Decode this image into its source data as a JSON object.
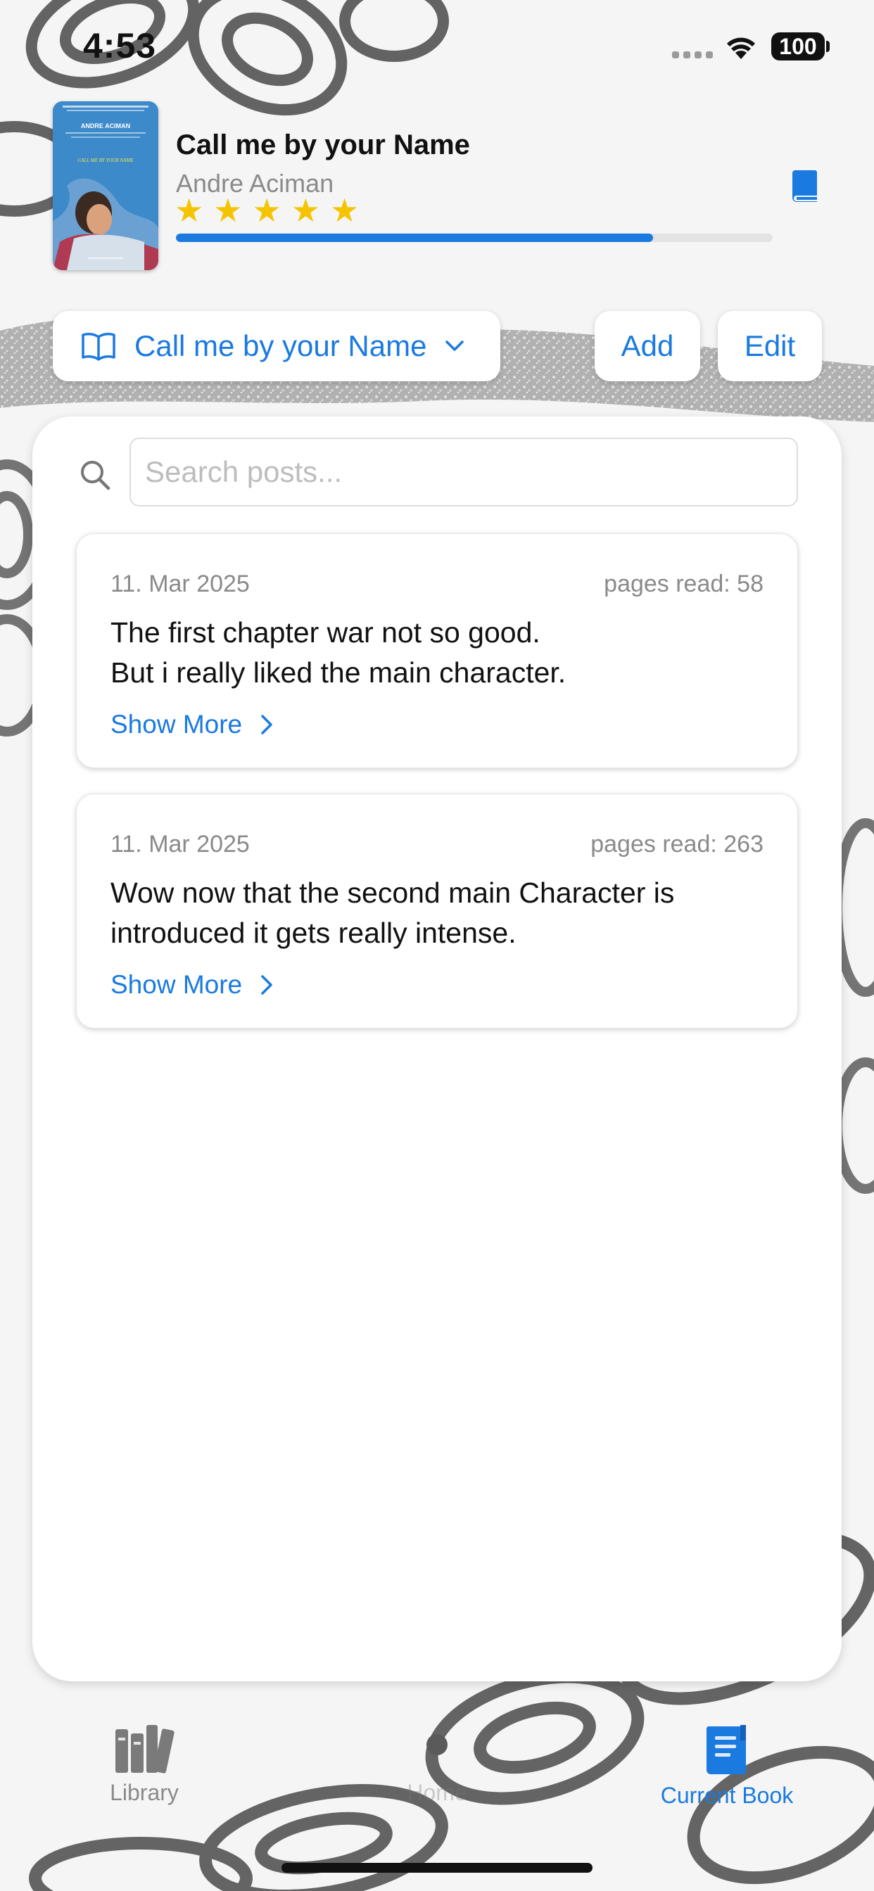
{
  "status_bar": {
    "time": "4:53",
    "battery": "100"
  },
  "current_book": {
    "title": "Call me by your Name",
    "author": "Andre Aciman",
    "rating": 5,
    "rating_max": 5,
    "stars": [
      "★",
      "★",
      "★",
      "★",
      "★"
    ],
    "reading_progress": 0.8,
    "cover_text": {
      "author": "ANDRE ACIMAN",
      "title": "CALL ME BY YOUR NAME"
    }
  },
  "controls": {
    "book_selector_label": "Call me by your Name",
    "add_label": "Add",
    "edit_label": "Edit"
  },
  "search": {
    "placeholder": "Search posts..."
  },
  "posts": [
    {
      "date": "11. Mar 2025",
      "pages_read": "pages read: 58",
      "text_lines": [
        "The first chapter war not so good.",
        "But i really liked the main character."
      ],
      "show_more": "Show More"
    },
    {
      "date": "11. Mar 2025",
      "pages_read": "pages read: 263",
      "text_lines": [
        "Wow now that the second main Character is",
        "introduced it gets really intense."
      ],
      "show_more": "Show More"
    }
  ],
  "tab_bar": {
    "items": [
      {
        "label": "Library",
        "icon": "books-icon",
        "active": false
      },
      {
        "label": "Home",
        "icon": "home-icon",
        "active": false
      },
      {
        "label": "Current Book",
        "icon": "current-book-icon",
        "active": true
      }
    ]
  },
  "colors": {
    "accent": "#1a7ae0",
    "star": "#f5c400",
    "muted_text": "#8a8a8a"
  }
}
